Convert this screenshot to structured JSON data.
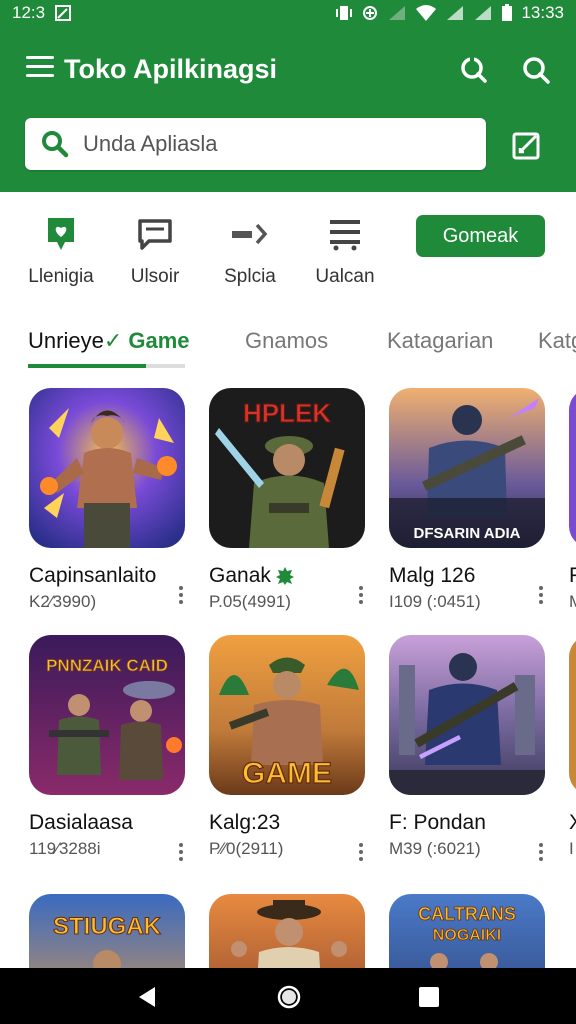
{
  "status_bar": {
    "time_left": "12:3",
    "time_right": "13:33"
  },
  "app_bar": {
    "title": "Toko Apilkinagsi",
    "search_placeholder": "Unda Apliasla"
  },
  "shortcuts": [
    {
      "label": "Llenigia",
      "icon": "chat-heart-icon"
    },
    {
      "label": "Ulsoir",
      "icon": "message-icon"
    },
    {
      "label": "Splcia",
      "icon": "arrow-right-icon"
    },
    {
      "label": "Ualcan",
      "icon": "list-icon"
    }
  ],
  "action_button": "Gomeak",
  "tabs": [
    {
      "label_prefix": "Unrieye",
      "label_suffix": "Game",
      "active": true
    },
    {
      "label": "Gnamos"
    },
    {
      "label": "Katagarian"
    },
    {
      "label": "Katg"
    }
  ],
  "apps": [
    {
      "title": "Capinsanlaito",
      "sub": "K2⁄3990)",
      "art": "hero-fire"
    },
    {
      "title": "Ganak",
      "sub": "P.05(4991)",
      "art": "soldier-knife",
      "banner": "HPLEK",
      "verified": true
    },
    {
      "title": "Malg 126",
      "sub": "I109 (:0451)",
      "art": "ninja-gun",
      "banner": "DFSARIN ADIA"
    },
    {
      "title": "P",
      "sub": "M",
      "art": "partial"
    },
    {
      "title": "Dasialaasa",
      "sub": "119⁄3288i",
      "art": "pnnzaik",
      "banner": "PNNZAIK CAID"
    },
    {
      "title": "Kalg:23",
      "sub": "P⁄⁄0(2911)",
      "art": "game-hero",
      "banner": "GAME"
    },
    {
      "title": "F: Pondan",
      "sub": "M39 (:6021)",
      "art": "blue-gunner"
    },
    {
      "title": "X",
      "sub": "I",
      "art": "partial"
    },
    {
      "title": "",
      "sub": "",
      "art": "stiugak",
      "banner": "STIUGAK"
    },
    {
      "title": "",
      "sub": "",
      "art": "cowboy"
    },
    {
      "title": "",
      "sub": "",
      "art": "caltrans",
      "banner": "CALTRANS NOGAIKI"
    }
  ],
  "colors": {
    "primary": "#1f8a3a"
  }
}
